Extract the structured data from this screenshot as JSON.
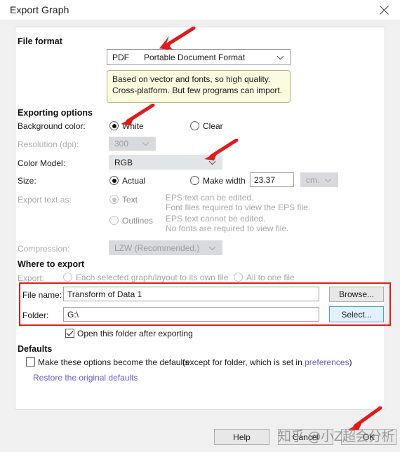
{
  "window": {
    "title": "Export Graph",
    "close_icon": "close-icon"
  },
  "file_format": {
    "heading": "File format",
    "combo": {
      "ext": "PDF",
      "description": "Portable Document Format",
      "chevron_icon": "chevron-down-icon"
    },
    "info": {
      "line1": "Based on vector and fonts, so high quality.",
      "line2": "Cross-platform. But few programs can import."
    }
  },
  "exporting_options": {
    "heading": "Exporting options",
    "background_color": {
      "label": "Background color:",
      "options": [
        "White",
        "Clear"
      ],
      "selected": "White"
    },
    "resolution": {
      "label": "Resolution (dpi):",
      "value": "300",
      "chevron_icon": "chevron-down-icon",
      "disabled": true
    },
    "color_model": {
      "label": "Color Model:",
      "value": "RGB",
      "chevron_icon": "chevron-down-icon"
    },
    "size": {
      "label": "Size:",
      "options": [
        "Actual",
        "Make width"
      ],
      "selected": "Actual",
      "width_value": "23.37",
      "unit": "cm.",
      "unit_chevron_icon": "chevron-down-icon"
    },
    "export_text_as": {
      "label": "Export text as:",
      "options": [
        "Text",
        "Outlines"
      ],
      "selected": "Text",
      "disabled": true,
      "text_note_line1": "EPS text can be edited.",
      "text_note_line2": "Font files required to view the EPS file.",
      "outlines_note_line1": "EPS text cannot be edited.",
      "outlines_note_line2": "No fonts are required to view file."
    },
    "compression": {
      "label": "Compression:",
      "value": "LZW (Recommended.)",
      "chevron_icon": "chevron-down-icon",
      "disabled": true
    }
  },
  "where_to_export": {
    "heading": "Where to export",
    "export_row": {
      "label": "Export:",
      "options": [
        "Each selected graph/layout to its own file",
        "All to one file"
      ],
      "selected": "",
      "disabled": true
    },
    "file_name": {
      "label": "File name:",
      "value": "Transform of Data 1",
      "button": "Browse..."
    },
    "folder": {
      "label": "Folder:",
      "value": "G:\\",
      "button": "Select..."
    },
    "open_folder": {
      "label": "Open this folder after exporting",
      "checked": true
    }
  },
  "defaults": {
    "heading": "Defaults",
    "make_default": {
      "label": "Make these options become the defaults",
      "checked": false
    },
    "note_prefix": "(except for folder, which is set in ",
    "note_link": "preferences",
    "note_suffix": ")",
    "restore_link": "Restore the original defaults"
  },
  "footer": {
    "help": "Help",
    "cancel": "Cancel",
    "ok": "OK"
  },
  "watermark": {
    "text": "知乎 @小Z超会分析"
  },
  "annotations": {
    "arrow_color": "#e01b1b",
    "box_color": "#e01b1b"
  }
}
